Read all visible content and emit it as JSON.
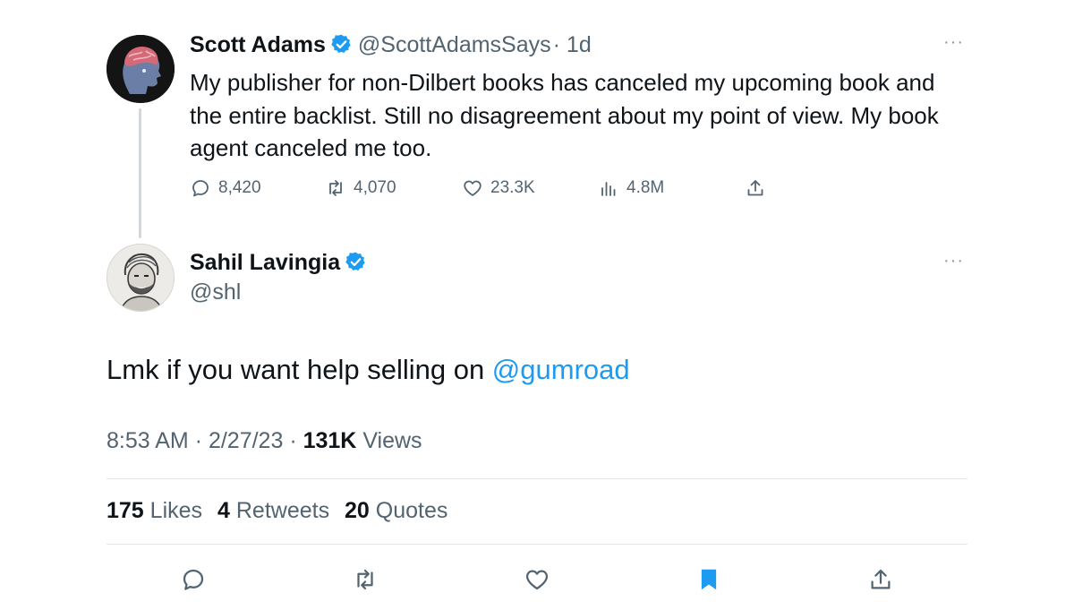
{
  "parent_tweet": {
    "name": "Scott Adams",
    "handle": "@ScottAdamsSays",
    "time": "· 1d",
    "text": "My publisher for non-Dilbert books has canceled my upcoming book and the entire backlist. Still no disagreement about my point of view. My book agent canceled me too.",
    "stats": {
      "replies": "8,420",
      "retweets": "4,070",
      "likes": "23.3K",
      "views": "4.8M"
    },
    "more_label": "···"
  },
  "reply_tweet": {
    "name": "Sahil Lavingia",
    "handle": "@shl",
    "text_prefix": "Lmk if you want help selling on ",
    "mention": "@gumroad",
    "time": "8:53 AM",
    "date": "2/27/23",
    "views_count": "131K",
    "views_label": "Views",
    "likes_count": "175",
    "likes_label": "Likes",
    "retweets_count": "4",
    "retweets_label": "Retweets",
    "quotes_count": "20",
    "quotes_label": "Quotes",
    "more_label": "···"
  },
  "colors": {
    "accent": "#1d9bf0",
    "text_primary": "#0f1419",
    "text_secondary": "#536471",
    "divider": "#e1e6ea"
  },
  "icons": {
    "verified": "verified-badge-icon",
    "reply": "speech-bubble-icon",
    "retweet": "retweet-arrows-icon",
    "like": "heart-icon",
    "views": "bar-chart-icon",
    "share": "share-upload-icon",
    "bookmark": "bookmark-filled-icon",
    "more": "ellipsis-icon"
  }
}
